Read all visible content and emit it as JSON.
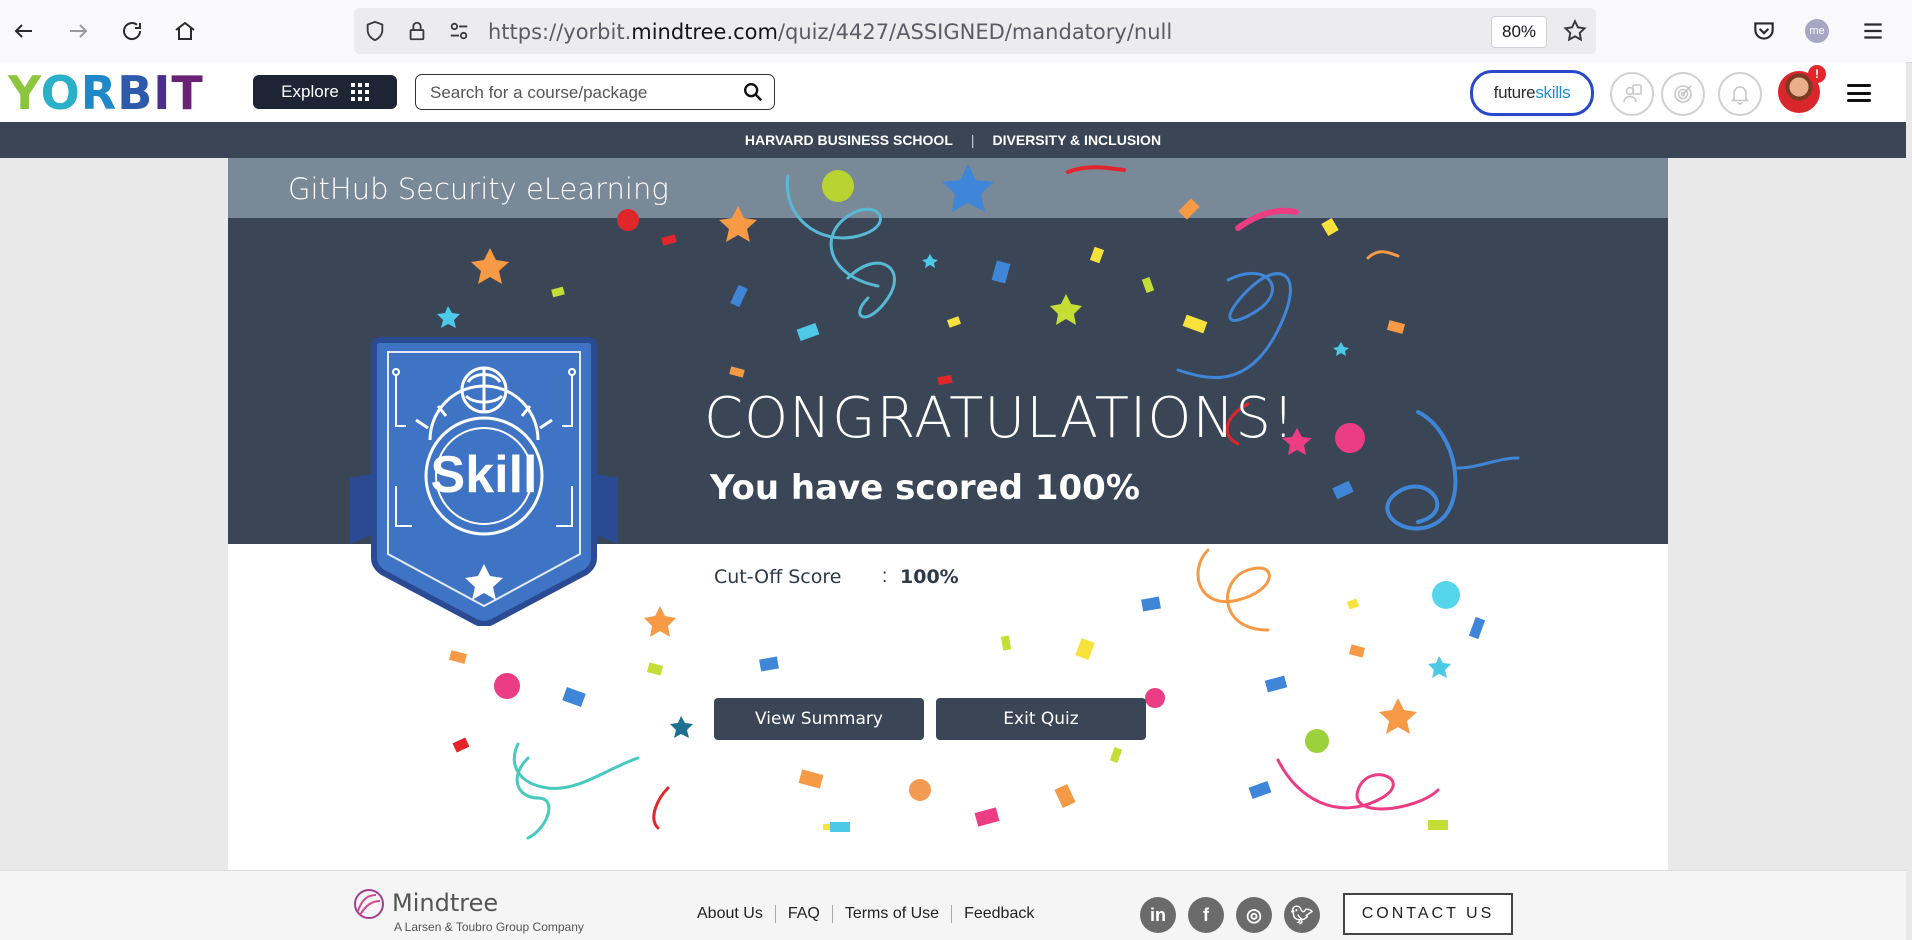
{
  "browser": {
    "url_prefix": "https://yorbit.",
    "url_domain": "mindtree.com",
    "url_path": "/quiz/4427/ASSIGNED/mandatory/null",
    "zoom": "80%",
    "account_badge": "me"
  },
  "header": {
    "logo_letters": [
      "Y",
      "O",
      "R",
      "B",
      "I",
      "T"
    ],
    "explore_label": "Explore",
    "search_placeholder": "Search for a course/package",
    "futureskills_prefix": "future",
    "futureskills_suffix": "skills",
    "notification_count": "!"
  },
  "subnav": {
    "items": [
      "HARVARD BUSINESS SCHOOL",
      "DIVERSITY & INCLUSION"
    ],
    "separator": "|"
  },
  "quiz": {
    "course_title": "GitHub Security eLearning",
    "badge_text": "Skill",
    "congrats": "CONGRATULATIONS!",
    "score_text": "You have scored 100%",
    "cutoff_label": "Cut-Off Score",
    "cutoff_colon": ":",
    "cutoff_value": "100%",
    "view_summary_label": "View Summary",
    "exit_quiz_label": "Exit Quiz"
  },
  "footer": {
    "company": "Mindtree",
    "company_sub": "A Larsen & Toubro Group Company",
    "links": [
      "About Us",
      "FAQ",
      "Terms of Use",
      "Feedback"
    ],
    "social": [
      {
        "name": "linkedin-icon",
        "glyph": "in"
      },
      {
        "name": "facebook-icon",
        "glyph": "f"
      },
      {
        "name": "instagram-icon",
        "glyph": "◎"
      },
      {
        "name": "twitter-icon",
        "glyph": "🐦︎"
      }
    ],
    "contact_label": "CONTACT US"
  },
  "colors": {
    "navy": "#3a4655",
    "title_bar": "#7a8998",
    "badge_blue": "#3f74c4",
    "futureskills_border": "#2948c8"
  }
}
